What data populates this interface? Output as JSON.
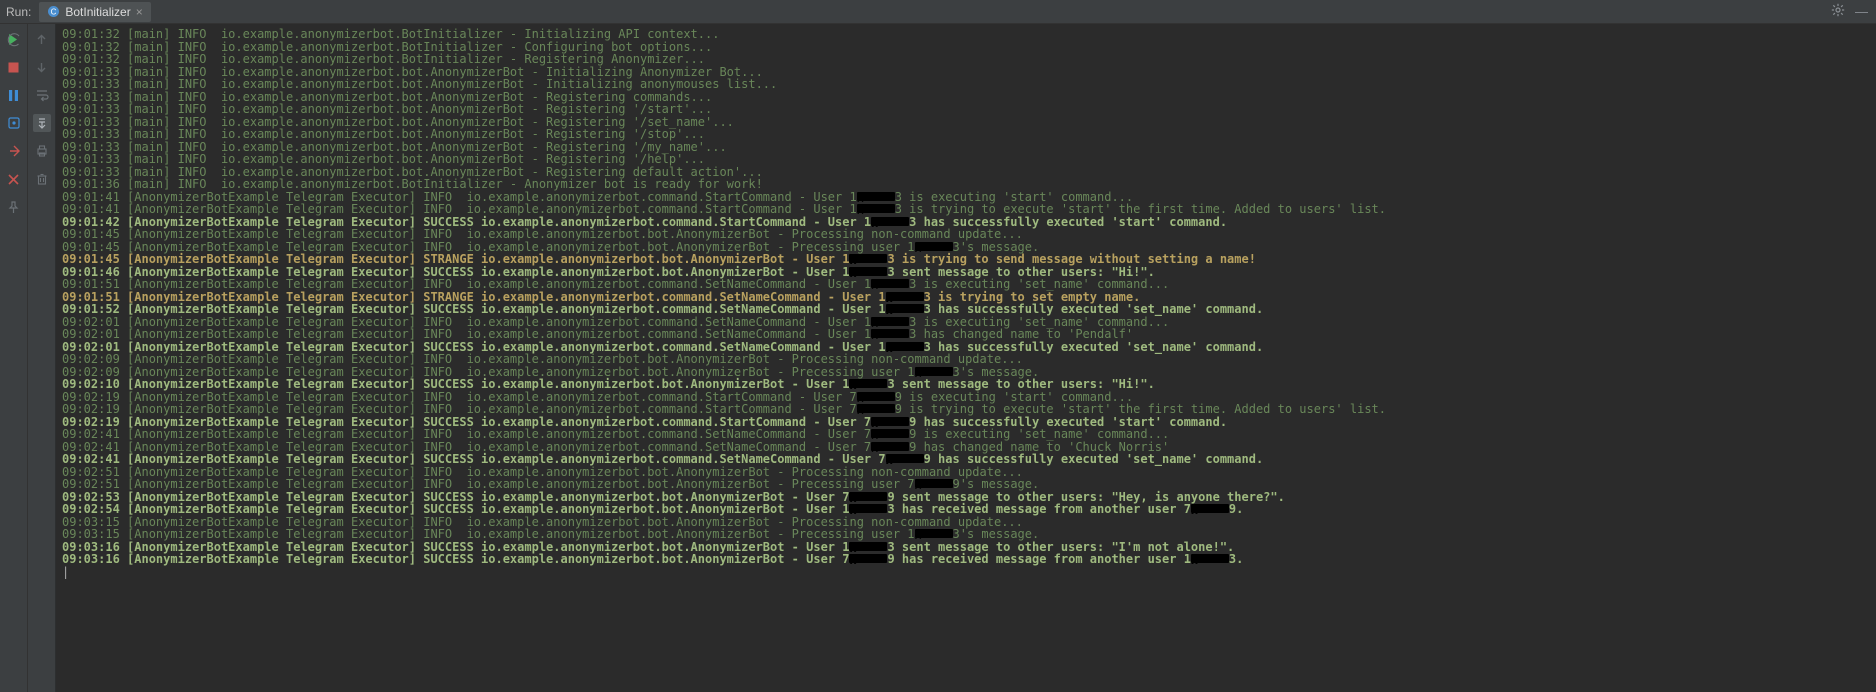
{
  "header": {
    "run_label": "Run:",
    "tab": {
      "icon": "class-icon",
      "label": "BotInitializer",
      "close": "×"
    },
    "right": {
      "gear": "⚙",
      "minimize": "—"
    }
  },
  "gutter1": {
    "rerun": "rerun-icon",
    "stop": "stop-icon",
    "pause": "pause-icon",
    "debug": "debug-icon",
    "cancel": "cancel-icon",
    "close": "close-config-icon",
    "help": "help-icon"
  },
  "gutter2": {
    "up": "step-up-icon",
    "down": "step-down-icon",
    "wrap": "soft-wrap-icon",
    "scroll": "scroll-to-end-icon",
    "print": "print-icon",
    "clear": "clear-all-icon"
  },
  "logs": [
    {
      "style": "plain",
      "prefix": "09:01:32 [main] INFO  io.example.anonymizerbot.BotInitializer - ",
      "msg": "Initializing API context..."
    },
    {
      "style": "plain",
      "prefix": "09:01:32 [main] INFO  io.example.anonymizerbot.BotInitializer - ",
      "msg": "Configuring bot options..."
    },
    {
      "style": "plain",
      "prefix": "09:01:32 [main] INFO  io.example.anonymizerbot.BotInitializer - ",
      "msg": "Registering Anonymizer..."
    },
    {
      "style": "plain",
      "prefix": "09:01:33 [main] INFO  io.example.anonymizerbot.bot.AnonymizerBot - ",
      "msg": "Initializing Anonymizer Bot..."
    },
    {
      "style": "plain",
      "prefix": "09:01:33 [main] INFO  io.example.anonymizerbot.bot.AnonymizerBot - ",
      "msg": "Initializing anonymouses list..."
    },
    {
      "style": "plain",
      "prefix": "09:01:33 [main] INFO  io.example.anonymizerbot.bot.AnonymizerBot - ",
      "msg": "Registering commands..."
    },
    {
      "style": "plain",
      "prefix": "09:01:33 [main] INFO  io.example.anonymizerbot.bot.AnonymizerBot - ",
      "msg": "Registering '/start'..."
    },
    {
      "style": "plain",
      "prefix": "09:01:33 [main] INFO  io.example.anonymizerbot.bot.AnonymizerBot - ",
      "msg": "Registering '/set_name'..."
    },
    {
      "style": "plain",
      "prefix": "09:01:33 [main] INFO  io.example.anonymizerbot.bot.AnonymizerBot - ",
      "msg": "Registering '/stop'..."
    },
    {
      "style": "plain",
      "prefix": "09:01:33 [main] INFO  io.example.anonymizerbot.bot.AnonymizerBot - ",
      "msg": "Registering '/my_name'..."
    },
    {
      "style": "plain",
      "prefix": "09:01:33 [main] INFO  io.example.anonymizerbot.bot.AnonymizerBot - ",
      "msg": "Registering '/help'..."
    },
    {
      "style": "plain",
      "prefix": "09:01:33 [main] INFO  io.example.anonymizerbot.bot.AnonymizerBot - ",
      "msg": "Registering default action'..."
    },
    {
      "style": "plain",
      "prefix": "09:01:36 [main] INFO  io.example.anonymizerbot.BotInitializer - ",
      "msg": "Anonymizer bot is ready for work!"
    },
    {
      "style": "user",
      "prefix": "09:01:41 [AnonymizerBotExample Telegram Executor] INFO  io.example.anonymizerbot.command.StartCommand - ",
      "u1": "User 1",
      "u2": "3",
      "msg": " is executing 'start' command..."
    },
    {
      "style": "user",
      "prefix": "09:01:41 [AnonymizerBotExample Telegram Executor] INFO  io.example.anonymizerbot.command.StartCommand - ",
      "u1": "User 1",
      "u2": "3",
      "msg": " is trying to execute 'start' the first time. Added to users' list."
    },
    {
      "style": "success",
      "prefix": "09:01:42 [AnonymizerBotExample Telegram Executor] SUCCESS io.example.anonymizerbot.command.StartCommand - ",
      "u1": "User 1",
      "u2": "3",
      "msg": " has successfully executed 'start' command."
    },
    {
      "style": "plain",
      "prefix": "09:01:45 [AnonymizerBotExample Telegram Executor] INFO  io.example.anonymizerbot.bot.AnonymizerBot - ",
      "msg": "Processing non-command update..."
    },
    {
      "style": "user",
      "prefix": "09:01:45 [AnonymizerBotExample Telegram Executor] INFO  io.example.anonymizerbot.bot.AnonymizerBot - ",
      "u1": "Precessing user 1",
      "u2": "3",
      "msg": "'s message."
    },
    {
      "style": "strange",
      "prefix": "09:01:45 [AnonymizerBotExample Telegram Executor] STRANGE io.example.anonymizerbot.bot.AnonymizerBot - ",
      "u1": "User 1",
      "u2": "3",
      "msg": " is trying to send message without setting a name!"
    },
    {
      "style": "success",
      "prefix": "09:01:46 [AnonymizerBotExample Telegram Executor] SUCCESS io.example.anonymizerbot.bot.AnonymizerBot - ",
      "u1": "User 1",
      "u2": "3",
      "msg": " sent message to other users: \"Hi!\"."
    },
    {
      "style": "user",
      "prefix": "09:01:51 [AnonymizerBotExample Telegram Executor] INFO  io.example.anonymizerbot.command.SetNameCommand - ",
      "u1": "User 1",
      "u2": "3",
      "msg": " is executing 'set_name' command..."
    },
    {
      "style": "strange",
      "prefix": "09:01:51 [AnonymizerBotExample Telegram Executor] STRANGE io.example.anonymizerbot.command.SetNameCommand - ",
      "u1": "User 1",
      "u2": "3",
      "msg": " is trying to set empty name."
    },
    {
      "style": "success",
      "prefix": "09:01:52 [AnonymizerBotExample Telegram Executor] SUCCESS io.example.anonymizerbot.command.SetNameCommand - ",
      "u1": "User 1",
      "u2": "3",
      "msg": " has successfully executed 'set_name' command."
    },
    {
      "style": "user",
      "prefix": "09:02:01 [AnonymizerBotExample Telegram Executor] INFO  io.example.anonymizerbot.command.SetNameCommand - ",
      "u1": "User 1",
      "u2": "3",
      "msg": " is executing 'set_name' command..."
    },
    {
      "style": "user",
      "prefix": "09:02:01 [AnonymizerBotExample Telegram Executor] INFO  io.example.anonymizerbot.command.SetNameCommand - ",
      "u1": "User 1",
      "u2": "3",
      "msg": " has changed name to 'Pendalf'"
    },
    {
      "style": "success",
      "prefix": "09:02:01 [AnonymizerBotExample Telegram Executor] SUCCESS io.example.anonymizerbot.command.SetNameCommand - ",
      "u1": "User 1",
      "u2": "3",
      "msg": " has successfully executed 'set_name' command."
    },
    {
      "style": "plain",
      "prefix": "09:02:09 [AnonymizerBotExample Telegram Executor] INFO  io.example.anonymizerbot.bot.AnonymizerBot - ",
      "msg": "Processing non-command update..."
    },
    {
      "style": "user",
      "prefix": "09:02:09 [AnonymizerBotExample Telegram Executor] INFO  io.example.anonymizerbot.bot.AnonymizerBot - ",
      "u1": "Precessing user 1",
      "u2": "3",
      "msg": "'s message."
    },
    {
      "style": "success",
      "prefix": "09:02:10 [AnonymizerBotExample Telegram Executor] SUCCESS io.example.anonymizerbot.bot.AnonymizerBot - ",
      "u1": "User 1",
      "u2": "3",
      "msg": " sent message to other users: \"Hi!\"."
    },
    {
      "style": "user",
      "prefix": "09:02:19 [AnonymizerBotExample Telegram Executor] INFO  io.example.anonymizerbot.command.StartCommand - ",
      "u1": "User 7",
      "u2": "9",
      "msg": " is executing 'start' command..."
    },
    {
      "style": "user",
      "prefix": "09:02:19 [AnonymizerBotExample Telegram Executor] INFO  io.example.anonymizerbot.command.StartCommand - ",
      "u1": "User 7",
      "u2": "9",
      "msg": " is trying to execute 'start' the first time. Added to users' list."
    },
    {
      "style": "success",
      "prefix": "09:02:19 [AnonymizerBotExample Telegram Executor] SUCCESS io.example.anonymizerbot.command.StartCommand - ",
      "u1": "User 7",
      "u2": "9",
      "msg": " has successfully executed 'start' command."
    },
    {
      "style": "user",
      "prefix": "09:02:41 [AnonymizerBotExample Telegram Executor] INFO  io.example.anonymizerbot.command.SetNameCommand - ",
      "u1": "User 7",
      "u2": "9",
      "msg": " is executing 'set_name' command..."
    },
    {
      "style": "user",
      "prefix": "09:02:41 [AnonymizerBotExample Telegram Executor] INFO  io.example.anonymizerbot.command.SetNameCommand - ",
      "u1": "User 7",
      "u2": "9",
      "msg": " has changed name to 'Chuck Norris'"
    },
    {
      "style": "success",
      "prefix": "09:02:41 [AnonymizerBotExample Telegram Executor] SUCCESS io.example.anonymizerbot.command.SetNameCommand - ",
      "u1": "User 7",
      "u2": "9",
      "msg": " has successfully executed 'set_name' command."
    },
    {
      "style": "plain",
      "prefix": "09:02:51 [AnonymizerBotExample Telegram Executor] INFO  io.example.anonymizerbot.bot.AnonymizerBot - ",
      "msg": "Processing non-command update..."
    },
    {
      "style": "user",
      "prefix": "09:02:51 [AnonymizerBotExample Telegram Executor] INFO  io.example.anonymizerbot.bot.AnonymizerBot - ",
      "u1": "Precessing user 7",
      "u2": "9",
      "msg": "'s message."
    },
    {
      "style": "success",
      "prefix": "09:02:53 [AnonymizerBotExample Telegram Executor] SUCCESS io.example.anonymizerbot.bot.AnonymizerBot - ",
      "u1": "User 7",
      "u2": "9",
      "msg": " sent message to other users: \"Hey, is anyone there?\"."
    },
    {
      "style": "success2",
      "prefix": "09:02:54 [AnonymizerBotExample Telegram Executor] SUCCESS io.example.anonymizerbot.bot.AnonymizerBot - ",
      "u1": "User 1",
      "u2": "3",
      "mid": " has received message from another user 7",
      "u3": "9",
      "msg": "."
    },
    {
      "style": "plain",
      "prefix": "09:03:15 [AnonymizerBotExample Telegram Executor] INFO  io.example.anonymizerbot.bot.AnonymizerBot - ",
      "msg": "Processing non-command update..."
    },
    {
      "style": "user",
      "prefix": "09:03:15 [AnonymizerBotExample Telegram Executor] INFO  io.example.anonymizerbot.bot.AnonymizerBot - ",
      "u1": "Precessing user 1",
      "u2": "3",
      "msg": "'s message."
    },
    {
      "style": "success",
      "prefix": "09:03:16 [AnonymizerBotExample Telegram Executor] SUCCESS io.example.anonymizerbot.bot.AnonymizerBot - ",
      "u1": "User 1",
      "u2": "3",
      "msg": " sent message to other users: \"I'm not alone!\"."
    },
    {
      "style": "success2",
      "prefix": "09:03:16 [AnonymizerBotExample Telegram Executor] SUCCESS io.example.anonymizerbot.bot.AnonymizerBot - ",
      "u1": "User 7",
      "u2": "9",
      "mid": " has received message from another user 1",
      "u3": "3",
      "msg": "."
    }
  ]
}
